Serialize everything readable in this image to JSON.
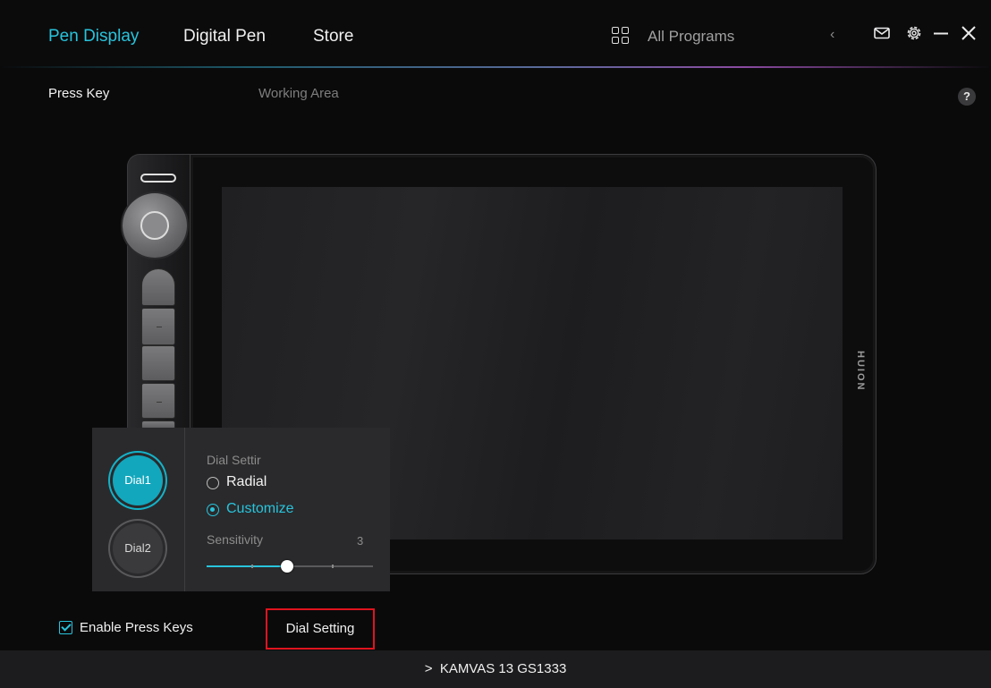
{
  "nav": {
    "tabs": [
      {
        "label": "Pen Display",
        "active": true
      },
      {
        "label": "Digital Pen",
        "active": false
      },
      {
        "label": "Store",
        "active": false
      }
    ],
    "programs_label": "All Programs",
    "icons": [
      "grid-icon",
      "chevron-left-icon",
      "mail-icon",
      "gear-icon",
      "minimize-icon",
      "close-icon"
    ]
  },
  "subtabs": [
    {
      "label": "Press Key",
      "active": true
    },
    {
      "label": "Working Area",
      "active": false
    }
  ],
  "help_label": "?",
  "tablet": {
    "brand": "HUION"
  },
  "dial_panel": {
    "dials": [
      {
        "label": "Dial1",
        "active": true
      },
      {
        "label": "Dial2",
        "active": false
      }
    ],
    "title": "Dial Settir",
    "modes": [
      {
        "label": "Radial",
        "checked": false
      },
      {
        "label": "Customize",
        "checked": true
      }
    ],
    "sensitivity_label": "Sensitivity",
    "sensitivity_value": "3",
    "sensitivity_level": 3,
    "sensitivity_max": 5
  },
  "bottom": {
    "enable_label": "Enable Press Keys",
    "enable_checked": true,
    "dial_setting_label": "Dial Setting"
  },
  "footer": {
    "device_label": "KAMVAS 13 GS1333",
    "chevron": ">"
  },
  "colors": {
    "accent": "#28c4dc",
    "highlight_border": "#e0141e",
    "background": "#0a0a0b"
  }
}
